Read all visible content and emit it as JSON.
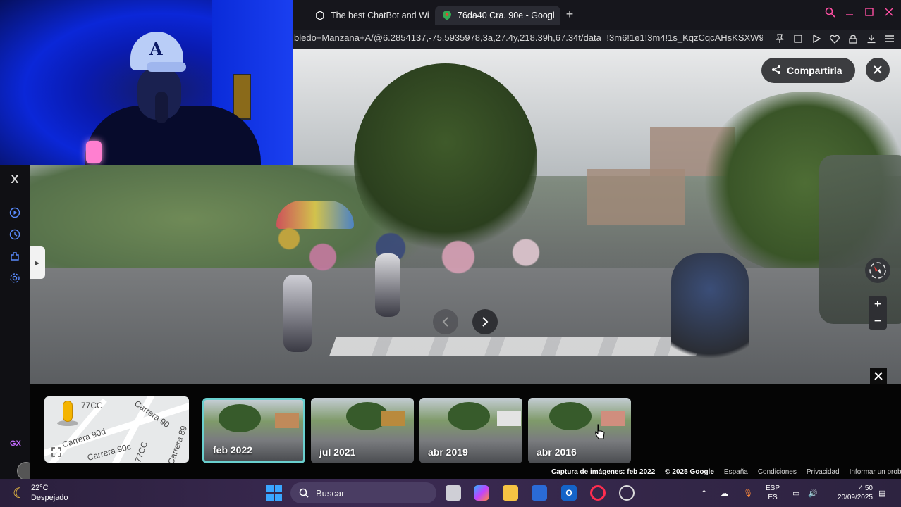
{
  "browser": {
    "tabs": [
      {
        "label": "The best ChatBot and Wi"
      },
      {
        "label": "76da40 Cra. 90e - Googl"
      }
    ],
    "url": "bledo+Manzana+A/@6.2854137,-75.5935978,3a,27.4y,218.39h,67.34t/data=!3m6!1e1!3m4!1s_KqzCqcAHsKSXW9"
  },
  "streetview": {
    "share_label": "Compartirla",
    "zoom_in": "+",
    "zoom_out": "−"
  },
  "timeline": {
    "minimap_labels": [
      "77CC",
      "Carrera 90",
      "Carrera 90d",
      "Carrera 90c",
      "77CC",
      "Carrera 89"
    ],
    "thumbnails": [
      {
        "label": "feb 2022",
        "selected": true
      },
      {
        "label": "jul 2021",
        "selected": false
      },
      {
        "label": "abr 2019",
        "selected": false
      },
      {
        "label": "abr 2016",
        "selected": false
      }
    ],
    "footer": {
      "capture": "Captura de imágenes: feb 2022",
      "copyright": "© 2025 Google",
      "links": [
        "España",
        "Condiciones",
        "Privacidad",
        "Informar un problema"
      ]
    }
  },
  "sidebar": {
    "top_label": "X",
    "gx_label": "GX"
  },
  "taskbar": {
    "weather_temp": "22°C",
    "weather_desc": "Despejado",
    "search_placeholder": "Buscar",
    "lang_top": "ESP",
    "lang_bottom": "ES",
    "time": "4:50",
    "date": "20/09/2025"
  },
  "colors": {
    "accent_pink": "#ff4fa3",
    "selected_border": "#6ad0cf",
    "taskbar": "#3b2a52"
  }
}
